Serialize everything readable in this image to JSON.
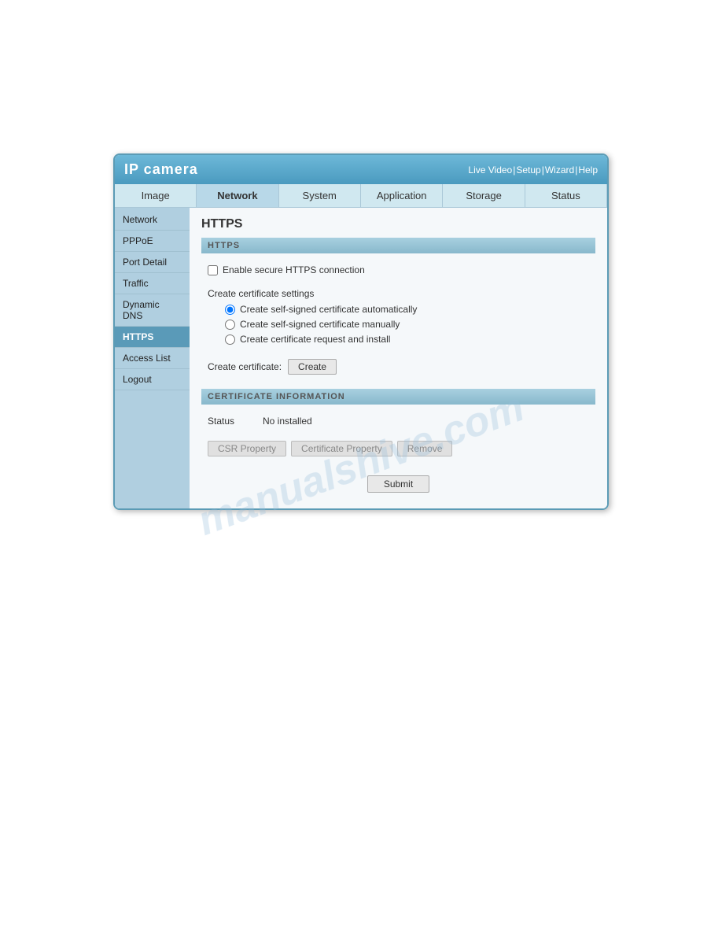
{
  "header": {
    "title": "IP camera",
    "nav": {
      "live_video": "Live Video",
      "setup": "Setup",
      "wizard": "Wizard",
      "help": "Help"
    }
  },
  "top_nav": {
    "items": [
      {
        "label": "Image",
        "active": false
      },
      {
        "label": "Network",
        "active": true
      },
      {
        "label": "System",
        "active": false
      },
      {
        "label": "Application",
        "active": false
      },
      {
        "label": "Storage",
        "active": false
      },
      {
        "label": "Status",
        "active": false
      }
    ]
  },
  "sidebar": {
    "items": [
      {
        "label": "Network",
        "active": false
      },
      {
        "label": "PPPoE",
        "active": false
      },
      {
        "label": "Port Detail",
        "active": false
      },
      {
        "label": "Traffic",
        "active": false
      },
      {
        "label": "Dynamic DNS",
        "active": false
      },
      {
        "label": "HTTPS",
        "active": true
      },
      {
        "label": "Access List",
        "active": false
      },
      {
        "label": "Logout",
        "active": false
      }
    ]
  },
  "content": {
    "title": "HTTPS",
    "https_section_header": "HTTPS",
    "enable_checkbox_label": "Enable secure HTTPS connection",
    "cert_settings_label": "Create certificate settings",
    "radio_options": [
      {
        "label": "Create self-signed certificate automatically",
        "checked": true
      },
      {
        "label": "Create self-signed certificate manually",
        "checked": false
      },
      {
        "label": "Create certificate request and install",
        "checked": false
      }
    ],
    "create_cert_label": "Create certificate:",
    "create_btn_label": "Create",
    "cert_info_header": "CERTIFICATE INFORMATION",
    "status_label": "Status",
    "status_value": "No installed",
    "csr_property_btn": "CSR Property",
    "cert_property_btn": "Certificate Property",
    "remove_btn": "Remove",
    "submit_btn": "Submit"
  },
  "watermark": "manualshive.com"
}
